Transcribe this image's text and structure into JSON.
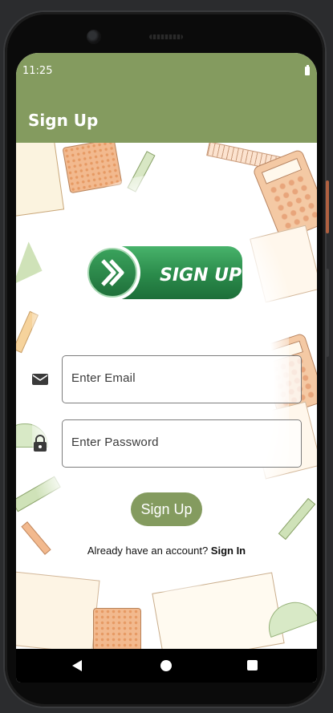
{
  "status_bar": {
    "time": "11:25"
  },
  "app_bar": {
    "title": "Sign Up"
  },
  "logo": {
    "text": "SIGN UP"
  },
  "form": {
    "email_placeholder": "Enter Email",
    "password_placeholder": "Enter Password",
    "submit_label": "Sign Up"
  },
  "footer": {
    "prompt": "Already have an account?",
    "link": "Sign In"
  },
  "colors": {
    "accent": "#849b5f",
    "logo_green": "#2e8b4f"
  }
}
